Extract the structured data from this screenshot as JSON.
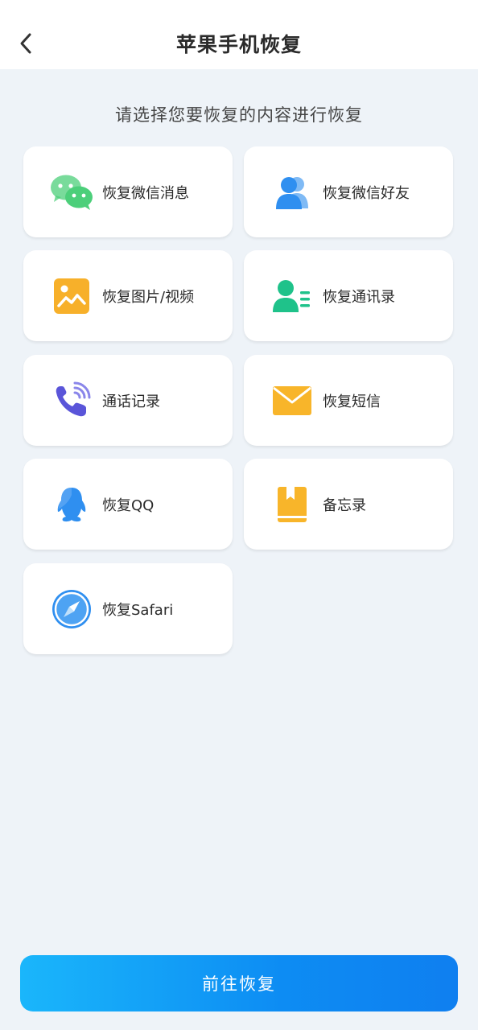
{
  "header": {
    "title": "苹果手机恢复",
    "back_icon": "chevron-left-icon"
  },
  "subtitle": "请选择您要恢复的内容进行恢复",
  "options": [
    {
      "label": "恢复微信消息",
      "icon": "wechat-icon",
      "color": "#4ccf7a"
    },
    {
      "label": "恢复微信好友",
      "icon": "contacts-people-icon",
      "color": "#2f8ff0"
    },
    {
      "label": "恢复图片/视频",
      "icon": "image-icon",
      "color": "#f7b02a"
    },
    {
      "label": "恢复通讯录",
      "icon": "address-book-icon",
      "color": "#1fc28a"
    },
    {
      "label": "通话记录",
      "icon": "phone-call-icon",
      "color": "#5a55d9"
    },
    {
      "label": "恢复短信",
      "icon": "envelope-icon",
      "color": "#f8b52a"
    },
    {
      "label": "恢复QQ",
      "icon": "qq-penguin-icon",
      "color": "#2f8ff0"
    },
    {
      "label": "备忘录",
      "icon": "memo-book-icon",
      "color": "#f8b52a"
    },
    {
      "label": "恢复Safari",
      "icon": "safari-compass-icon",
      "color": "#2f8ff0"
    }
  ],
  "cta": {
    "label": "前往恢复"
  },
  "colors": {
    "background": "#eef3f8",
    "accent": "#0f8cf3"
  }
}
